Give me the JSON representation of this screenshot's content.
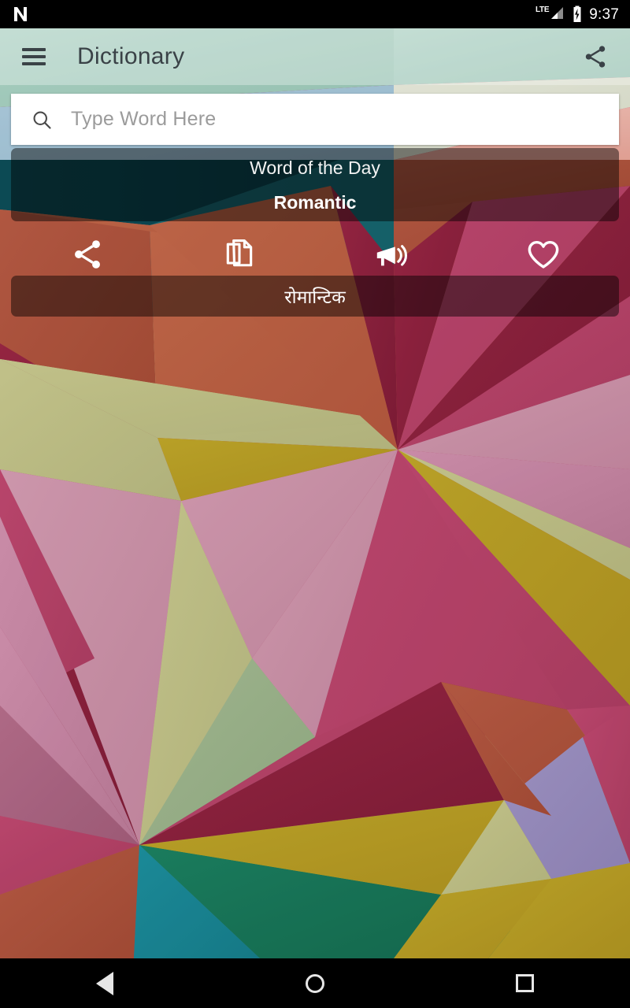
{
  "status_bar": {
    "logo_icon": "android-n-logo-icon",
    "network_label": "LTE",
    "signal_icon": "signal-triangle-icon",
    "battery_icon": "battery-charging-icon",
    "time": "9:37"
  },
  "app_bar": {
    "menu_icon": "hamburger-menu-icon",
    "title": "Dictionary",
    "share_icon": "share-icon"
  },
  "search": {
    "icon": "search-icon",
    "placeholder": "Type Word Here",
    "value": ""
  },
  "word_of_the_day": {
    "label": "Word of the Day",
    "word": "Romantic",
    "translation": "रोमान्टिक"
  },
  "actions": [
    {
      "name": "share-action",
      "icon": "share-icon",
      "label": "Share"
    },
    {
      "name": "copy-action",
      "icon": "copy-documents-icon",
      "label": "Copy"
    },
    {
      "name": "speak-action",
      "icon": "megaphone-sound-icon",
      "label": "Speak"
    },
    {
      "name": "favorite-action",
      "icon": "heart-outline-icon",
      "label": "Favorite"
    }
  ],
  "nav_bar": {
    "back_icon": "nav-back-triangle-icon",
    "home_icon": "nav-home-circle-icon",
    "recents_icon": "nav-recents-square-icon"
  },
  "colors": {
    "status_bar_bg": "#000000",
    "app_bar_overlay": "rgba(255,255,255,0.30)",
    "app_bar_text": "#3a4247",
    "search_bg": "#ffffff",
    "search_placeholder": "#9b9b9b",
    "card_overlay": "rgba(0,0,0,0.46)",
    "card_text": "#ffffff",
    "nav_bar_bg": "#000000",
    "nav_icon": "#e6e6e6"
  },
  "wallpaper": {
    "style": "low-poly-triangles",
    "palette": [
      "#a9d6c7",
      "#e6e9d8",
      "#f2b3a8",
      "#a8c8dd",
      "#1d6b74",
      "#0f5560",
      "#c0654a",
      "#a33b4a",
      "#8e1f3f",
      "#c2456e",
      "#cf7e9c",
      "#d79bb0",
      "#c9b96f",
      "#b89a26",
      "#c8c98e",
      "#a9bf8c",
      "#8fae96",
      "#1f7f63",
      "#1a8a99",
      "#9b8fc0"
    ]
  }
}
